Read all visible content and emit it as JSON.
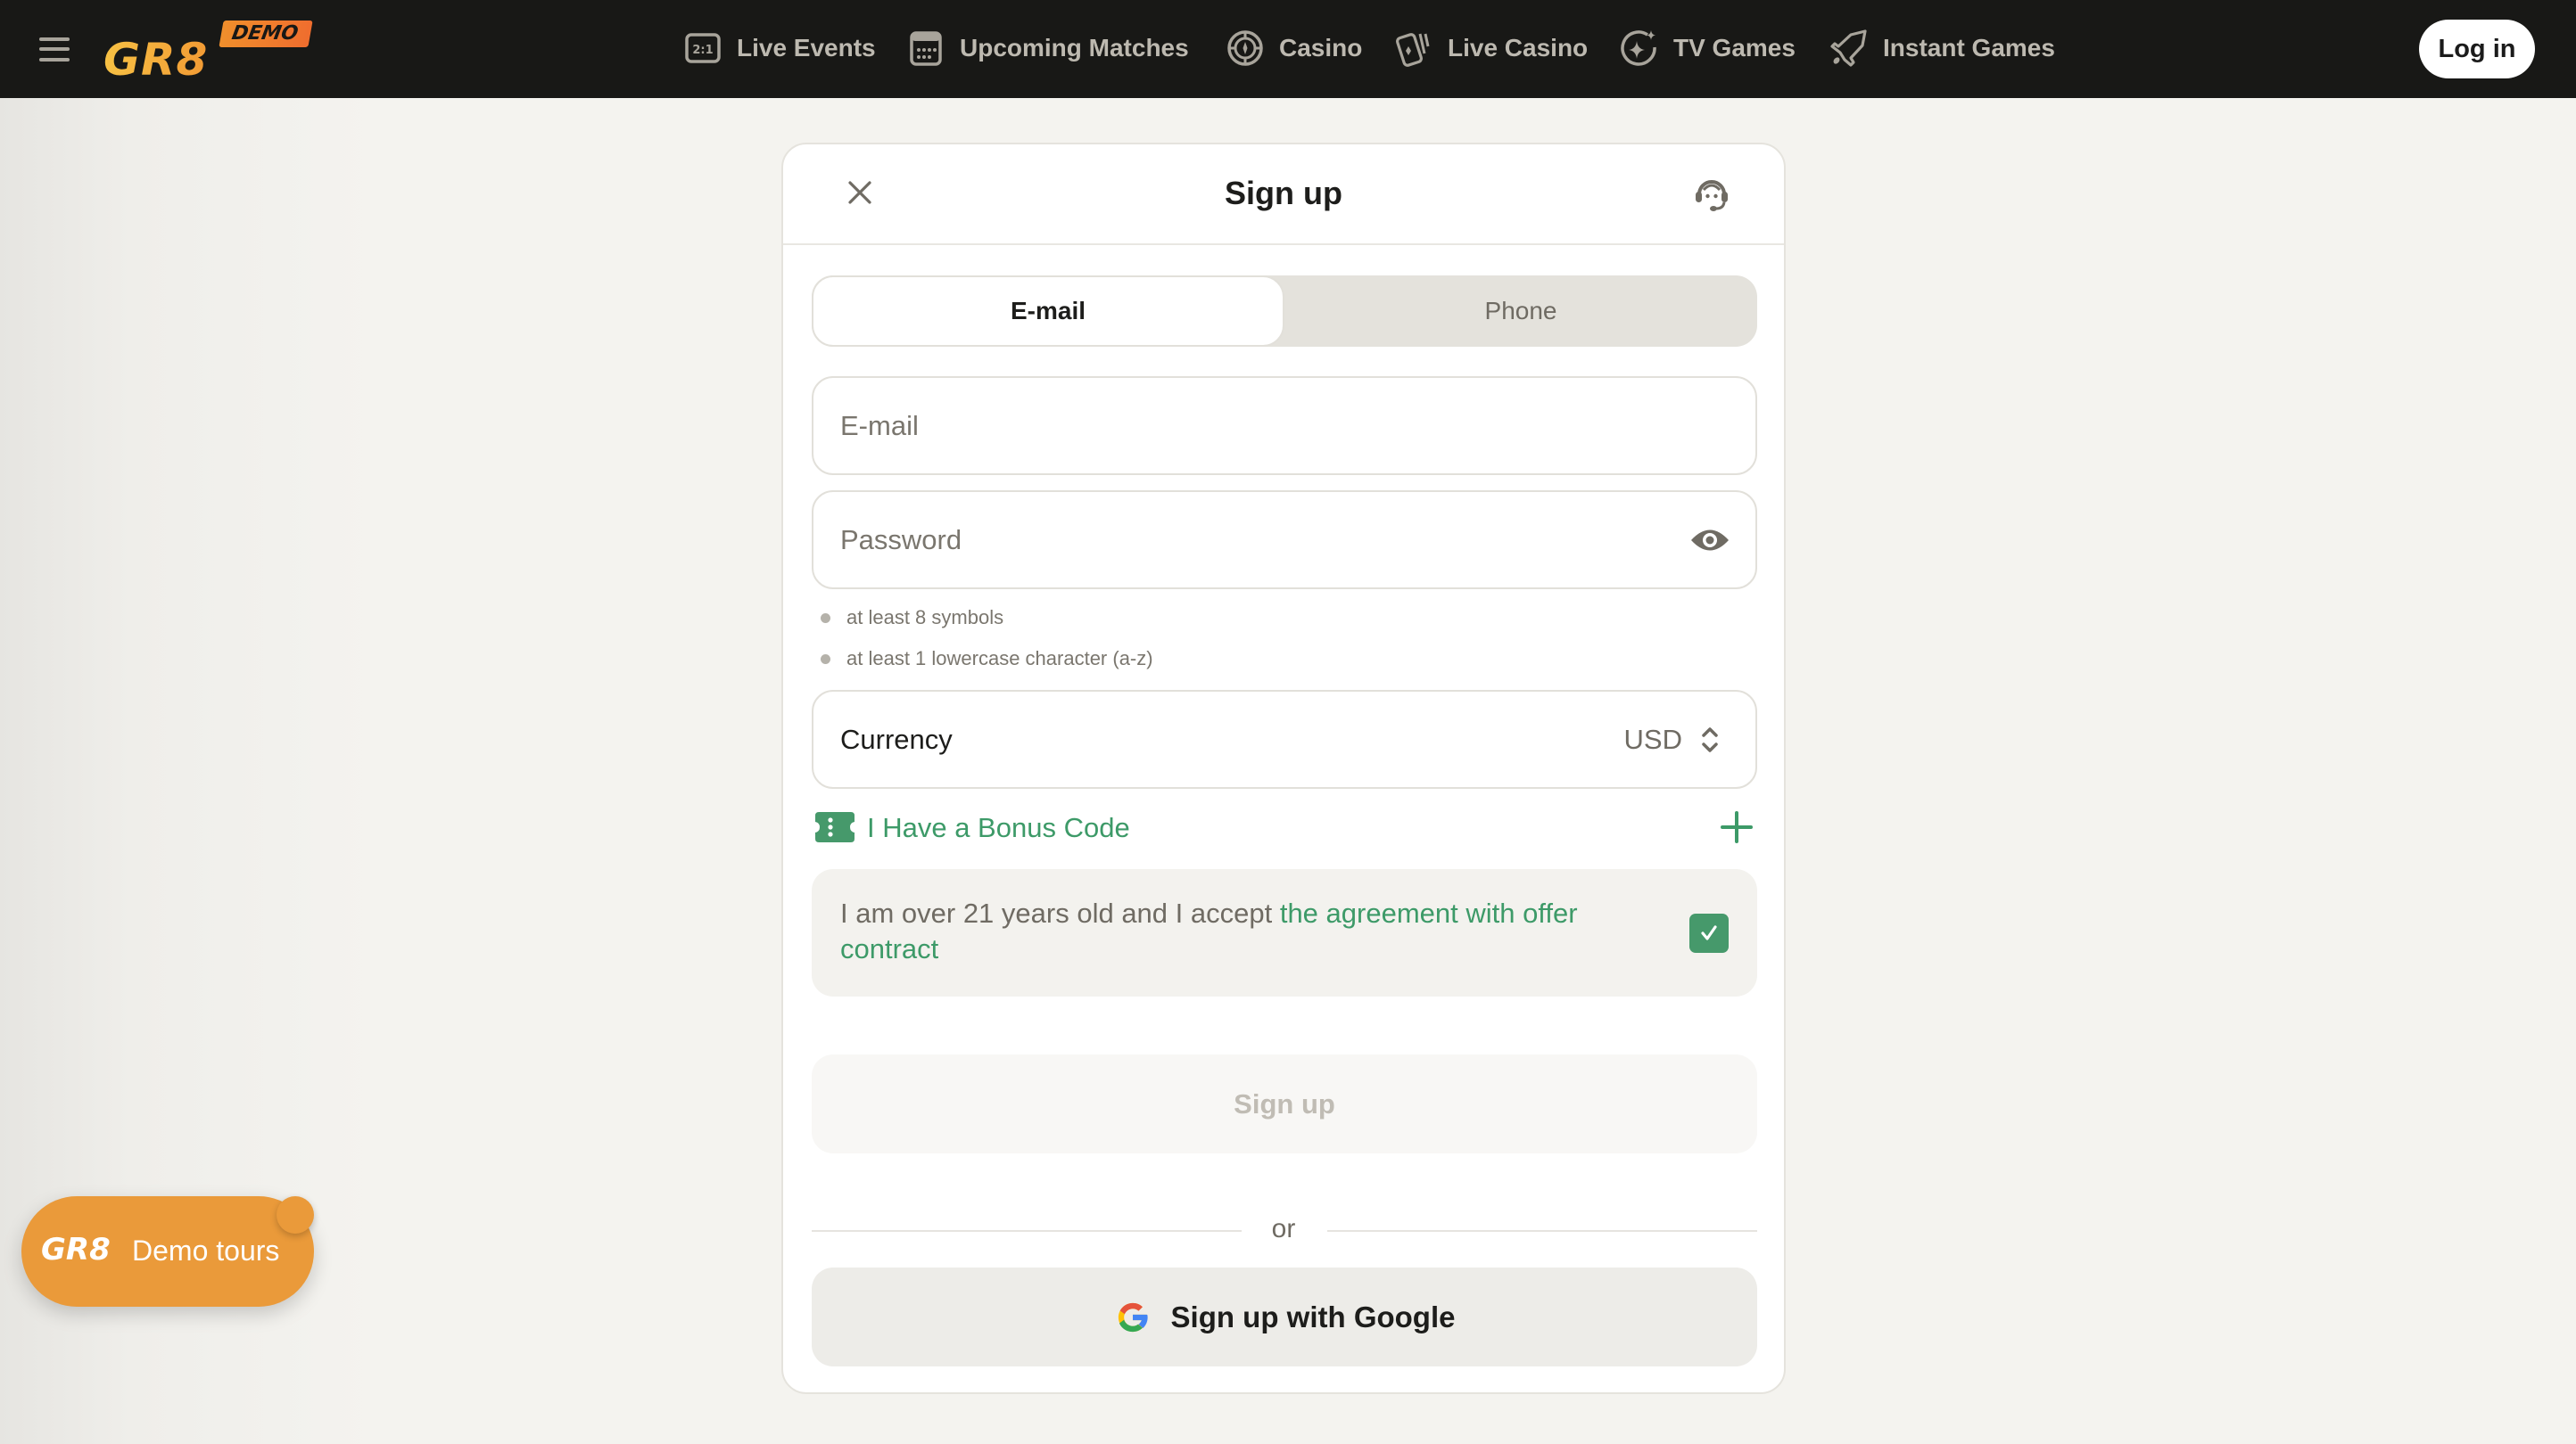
{
  "header": {
    "menu_icon": "hamburger-menu-icon",
    "logo_text": "GR8",
    "logo_badge": "DEMO",
    "nav": [
      {
        "label": "Live Events",
        "icon": "scoreboard-icon"
      },
      {
        "label": "Upcoming Matches",
        "icon": "calendar-icon"
      },
      {
        "label": "Casino",
        "icon": "casino-chip-icon"
      },
      {
        "label": "Live Casino",
        "icon": "playing-cards-icon"
      },
      {
        "label": "TV Games",
        "icon": "sparkle-circle-icon"
      },
      {
        "label": "Instant Games",
        "icon": "rocket-icon"
      }
    ],
    "login_label": "Log in"
  },
  "modal": {
    "title": "Sign up",
    "close_icon": "close-icon",
    "support_icon": "headset-support-icon",
    "tabs": [
      {
        "label": "E-mail",
        "active": true
      },
      {
        "label": "Phone",
        "active": false
      }
    ],
    "email": {
      "placeholder": "E-mail",
      "value": ""
    },
    "password": {
      "placeholder": "Password",
      "value": "",
      "toggle_icon": "eye-icon"
    },
    "password_hints": [
      "at least 8 symbols",
      "at least 1 lowercase character (a-z)"
    ],
    "currency": {
      "label": "Currency",
      "value": "USD",
      "icon": "chevron-updown-icon"
    },
    "bonus": {
      "label": "I Have a Bonus Code",
      "icon": "ticket-icon",
      "action_icon": "plus-icon"
    },
    "agreement": {
      "text": "I am over 21 years old and I accept ",
      "link": "the agreement with offer contract",
      "checked": true
    },
    "signup_label": "Sign up",
    "or_label": "or",
    "google_label": "Sign up with Google"
  },
  "demo_tours": {
    "logo_text": "GR8",
    "label": "Demo tours"
  },
  "colors": {
    "header_bg": "#181816",
    "accent_green": "#3d9a68",
    "accent_orange": "#ea9a3a",
    "page_bg": "#f4f3ef"
  }
}
